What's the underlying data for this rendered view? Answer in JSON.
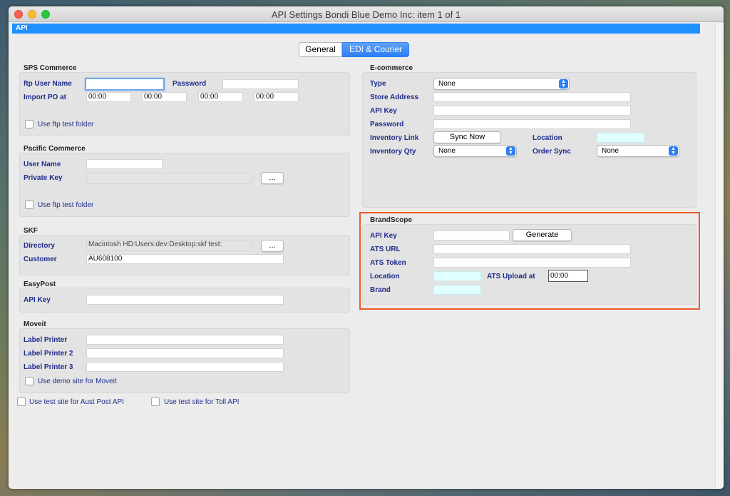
{
  "window": {
    "title": "API Settings    Bondi Blue Demo Inc: item 1  of  1"
  },
  "api_bar": {
    "label": "API"
  },
  "tabs": [
    {
      "label": "General",
      "selected": false
    },
    {
      "label": "EDI & Courier",
      "selected": true
    }
  ],
  "sps": {
    "title": "SPS Commerce",
    "ftp_user_label": "ftp User Name",
    "ftp_user_value": "",
    "password_label": "Password",
    "password_value": "",
    "import_label": "Import PO at",
    "import_times": [
      "00:00",
      "00:00",
      "00:00",
      "00:00"
    ],
    "test_folder_label": "Use ftp test folder"
  },
  "pacific": {
    "title": "Pacific Commerce",
    "user_label": "User Name",
    "user_value": "",
    "key_label": "Private Key",
    "key_value": "",
    "browse_label": "...",
    "test_folder_label": "Use ftp test folder"
  },
  "skf": {
    "title": "SKF",
    "directory_label": "Directory",
    "directory_value": "Macintosh HD:Users:dev:Desktop:skf test:",
    "browse_label": "...",
    "customer_label": "Customer",
    "customer_value": "AU608100"
  },
  "easypost": {
    "title": "EasyPost",
    "api_key_label": "API Key",
    "api_key_value": ""
  },
  "moveit": {
    "title": "Moveit",
    "printer1_label": "Label Printer",
    "printer2_label": "Label Printer 2",
    "printer3_label": "Label Printer 3",
    "demo_label": "Use demo site for Moveit"
  },
  "bottom": {
    "aust_post_label": "Use test site for Aust Post API",
    "toll_label": "Use test site for Toll API"
  },
  "ecommerce": {
    "title": "E-commerce",
    "type_label": "Type",
    "type_value": "None",
    "store_label": "Store Address",
    "api_key_label": "API Key",
    "password_label": "Password",
    "inventory_link_label": "Inventory Link",
    "sync_now_label": "Sync Now",
    "location_label": "Location",
    "inventory_qty_label": "Inventory Qty",
    "inventory_qty_value": "None",
    "order_sync_label": "Order Sync",
    "order_sync_value": "None"
  },
  "brandscope": {
    "title": "BrandScope",
    "api_key_label": "API Key",
    "generate_label": "Generate",
    "ats_url_label": "ATS URL",
    "ats_token_label": "ATS Token",
    "location_label": "Location",
    "ats_upload_label": "ATS Upload at",
    "ats_upload_value": "00:00",
    "brand_label": "Brand"
  },
  "colors": {
    "accent": "#1e90ff",
    "highlight": "#ef5a2a",
    "label": "#1f2c8c",
    "cyan_field": "#e0ffff"
  }
}
